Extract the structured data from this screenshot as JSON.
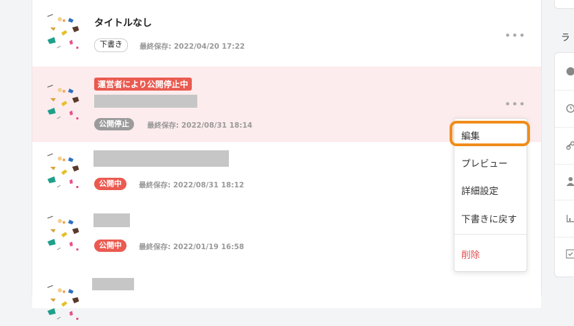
{
  "articles": [
    {
      "title": "タイトルなし",
      "status": "下書き",
      "saved": "最終保存: 2022/04/20 17:22"
    },
    {
      "alert": "運営者により公開停止中",
      "status": "公開停止",
      "saved": "最終保存: 2022/08/31 18:14"
    },
    {
      "status": "公開中",
      "saved": "最終保存: 2022/08/31 18:12"
    },
    {
      "status": "公開中",
      "saved": "最終保存: 2022/01/19 16:58"
    },
    {}
  ],
  "more_icon": "•••",
  "menu": {
    "items": [
      "編集",
      "プレビュー",
      "詳細設定",
      "下書きに戻す",
      "削除"
    ]
  },
  "right_panel": {
    "label": "ラ",
    "icons": [
      "yen-icon",
      "clock-icon",
      "link-icon",
      "user-icon",
      "chart-icon",
      "check-icon"
    ]
  },
  "colors": {
    "accent_highlight": "#f08c1a",
    "published": "#ea5a50",
    "stopped_bg": "#fdeced",
    "stopped_badge": "#9b9b9b"
  }
}
